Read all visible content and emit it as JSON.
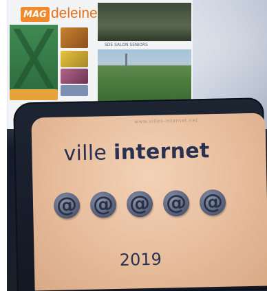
{
  "screen": {
    "mag_logo": "MAG",
    "mag_word": "deleine",
    "photo_caption": "SDE SALON SENIORS"
  },
  "plaque": {
    "url": "www.villes-internet.net",
    "title_light": "ville ",
    "title_bold": "internet",
    "at_symbols": [
      "@",
      "@",
      "@",
      "@",
      "@"
    ],
    "year": "2019"
  }
}
